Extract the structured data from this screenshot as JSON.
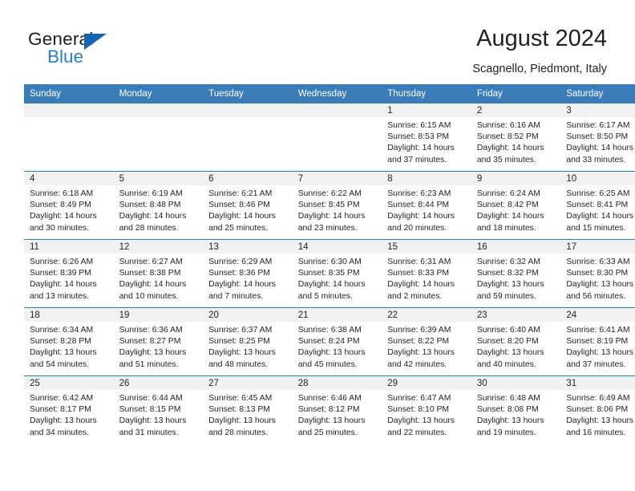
{
  "brand": {
    "name_top": "General",
    "name_bottom": "Blue",
    "triangle_color": "#1565b0",
    "blue_color": "#2980c4"
  },
  "header": {
    "title": "August 2024",
    "subtitle": "Scagnello, Piedmont, Italy"
  },
  "theme": {
    "header_bg": "#3a7cb9",
    "daynum_bg": "#f1f1f1",
    "text": "#231f20",
    "grid_line": "#3a7cb9"
  },
  "calendar": {
    "weekday_headers": [
      "Sunday",
      "Monday",
      "Tuesday",
      "Wednesday",
      "Thursday",
      "Friday",
      "Saturday"
    ],
    "labels": {
      "sunrise": "Sunrise:",
      "sunset": "Sunset:",
      "daylight": "Daylight:"
    },
    "weeks": [
      [
        {
          "day": ""
        },
        {
          "day": ""
        },
        {
          "day": ""
        },
        {
          "day": ""
        },
        {
          "day": "1",
          "sunrise": "Sunrise: 6:15 AM",
          "sunset": "Sunset: 8:53 PM",
          "daylight_1": "Daylight: 14 hours",
          "daylight_2": "and 37 minutes."
        },
        {
          "day": "2",
          "sunrise": "Sunrise: 6:16 AM",
          "sunset": "Sunset: 8:52 PM",
          "daylight_1": "Daylight: 14 hours",
          "daylight_2": "and 35 minutes."
        },
        {
          "day": "3",
          "sunrise": "Sunrise: 6:17 AM",
          "sunset": "Sunset: 8:50 PM",
          "daylight_1": "Daylight: 14 hours",
          "daylight_2": "and 33 minutes."
        }
      ],
      [
        {
          "day": "4",
          "sunrise": "Sunrise: 6:18 AM",
          "sunset": "Sunset: 8:49 PM",
          "daylight_1": "Daylight: 14 hours",
          "daylight_2": "and 30 minutes."
        },
        {
          "day": "5",
          "sunrise": "Sunrise: 6:19 AM",
          "sunset": "Sunset: 8:48 PM",
          "daylight_1": "Daylight: 14 hours",
          "daylight_2": "and 28 minutes."
        },
        {
          "day": "6",
          "sunrise": "Sunrise: 6:21 AM",
          "sunset": "Sunset: 8:46 PM",
          "daylight_1": "Daylight: 14 hours",
          "daylight_2": "and 25 minutes."
        },
        {
          "day": "7",
          "sunrise": "Sunrise: 6:22 AM",
          "sunset": "Sunset: 8:45 PM",
          "daylight_1": "Daylight: 14 hours",
          "daylight_2": "and 23 minutes."
        },
        {
          "day": "8",
          "sunrise": "Sunrise: 6:23 AM",
          "sunset": "Sunset: 8:44 PM",
          "daylight_1": "Daylight: 14 hours",
          "daylight_2": "and 20 minutes."
        },
        {
          "day": "9",
          "sunrise": "Sunrise: 6:24 AM",
          "sunset": "Sunset: 8:42 PM",
          "daylight_1": "Daylight: 14 hours",
          "daylight_2": "and 18 minutes."
        },
        {
          "day": "10",
          "sunrise": "Sunrise: 6:25 AM",
          "sunset": "Sunset: 8:41 PM",
          "daylight_1": "Daylight: 14 hours",
          "daylight_2": "and 15 minutes."
        }
      ],
      [
        {
          "day": "11",
          "sunrise": "Sunrise: 6:26 AM",
          "sunset": "Sunset: 8:39 PM",
          "daylight_1": "Daylight: 14 hours",
          "daylight_2": "and 13 minutes."
        },
        {
          "day": "12",
          "sunrise": "Sunrise: 6:27 AM",
          "sunset": "Sunset: 8:38 PM",
          "daylight_1": "Daylight: 14 hours",
          "daylight_2": "and 10 minutes."
        },
        {
          "day": "13",
          "sunrise": "Sunrise: 6:29 AM",
          "sunset": "Sunset: 8:36 PM",
          "daylight_1": "Daylight: 14 hours",
          "daylight_2": "and 7 minutes."
        },
        {
          "day": "14",
          "sunrise": "Sunrise: 6:30 AM",
          "sunset": "Sunset: 8:35 PM",
          "daylight_1": "Daylight: 14 hours",
          "daylight_2": "and 5 minutes."
        },
        {
          "day": "15",
          "sunrise": "Sunrise: 6:31 AM",
          "sunset": "Sunset: 8:33 PM",
          "daylight_1": "Daylight: 14 hours",
          "daylight_2": "and 2 minutes."
        },
        {
          "day": "16",
          "sunrise": "Sunrise: 6:32 AM",
          "sunset": "Sunset: 8:32 PM",
          "daylight_1": "Daylight: 13 hours",
          "daylight_2": "and 59 minutes."
        },
        {
          "day": "17",
          "sunrise": "Sunrise: 6:33 AM",
          "sunset": "Sunset: 8:30 PM",
          "daylight_1": "Daylight: 13 hours",
          "daylight_2": "and 56 minutes."
        }
      ],
      [
        {
          "day": "18",
          "sunrise": "Sunrise: 6:34 AM",
          "sunset": "Sunset: 8:28 PM",
          "daylight_1": "Daylight: 13 hours",
          "daylight_2": "and 54 minutes."
        },
        {
          "day": "19",
          "sunrise": "Sunrise: 6:36 AM",
          "sunset": "Sunset: 8:27 PM",
          "daylight_1": "Daylight: 13 hours",
          "daylight_2": "and 51 minutes."
        },
        {
          "day": "20",
          "sunrise": "Sunrise: 6:37 AM",
          "sunset": "Sunset: 8:25 PM",
          "daylight_1": "Daylight: 13 hours",
          "daylight_2": "and 48 minutes."
        },
        {
          "day": "21",
          "sunrise": "Sunrise: 6:38 AM",
          "sunset": "Sunset: 8:24 PM",
          "daylight_1": "Daylight: 13 hours",
          "daylight_2": "and 45 minutes."
        },
        {
          "day": "22",
          "sunrise": "Sunrise: 6:39 AM",
          "sunset": "Sunset: 8:22 PM",
          "daylight_1": "Daylight: 13 hours",
          "daylight_2": "and 42 minutes."
        },
        {
          "day": "23",
          "sunrise": "Sunrise: 6:40 AM",
          "sunset": "Sunset: 8:20 PM",
          "daylight_1": "Daylight: 13 hours",
          "daylight_2": "and 40 minutes."
        },
        {
          "day": "24",
          "sunrise": "Sunrise: 6:41 AM",
          "sunset": "Sunset: 8:19 PM",
          "daylight_1": "Daylight: 13 hours",
          "daylight_2": "and 37 minutes."
        }
      ],
      [
        {
          "day": "25",
          "sunrise": "Sunrise: 6:42 AM",
          "sunset": "Sunset: 8:17 PM",
          "daylight_1": "Daylight: 13 hours",
          "daylight_2": "and 34 minutes."
        },
        {
          "day": "26",
          "sunrise": "Sunrise: 6:44 AM",
          "sunset": "Sunset: 8:15 PM",
          "daylight_1": "Daylight: 13 hours",
          "daylight_2": "and 31 minutes."
        },
        {
          "day": "27",
          "sunrise": "Sunrise: 6:45 AM",
          "sunset": "Sunset: 8:13 PM",
          "daylight_1": "Daylight: 13 hours",
          "daylight_2": "and 28 minutes."
        },
        {
          "day": "28",
          "sunrise": "Sunrise: 6:46 AM",
          "sunset": "Sunset: 8:12 PM",
          "daylight_1": "Daylight: 13 hours",
          "daylight_2": "and 25 minutes."
        },
        {
          "day": "29",
          "sunrise": "Sunrise: 6:47 AM",
          "sunset": "Sunset: 8:10 PM",
          "daylight_1": "Daylight: 13 hours",
          "daylight_2": "and 22 minutes."
        },
        {
          "day": "30",
          "sunrise": "Sunrise: 6:48 AM",
          "sunset": "Sunset: 8:08 PM",
          "daylight_1": "Daylight: 13 hours",
          "daylight_2": "and 19 minutes."
        },
        {
          "day": "31",
          "sunrise": "Sunrise: 6:49 AM",
          "sunset": "Sunset: 8:06 PM",
          "daylight_1": "Daylight: 13 hours",
          "daylight_2": "and 16 minutes."
        }
      ]
    ]
  }
}
